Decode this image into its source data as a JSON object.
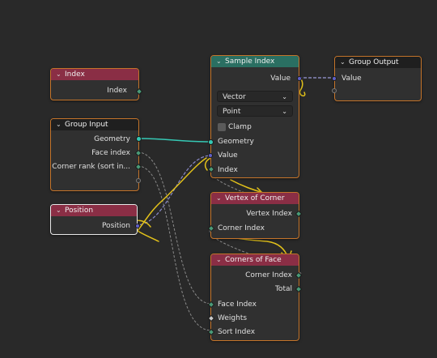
{
  "nodes": {
    "index": {
      "title": "Index",
      "output": "Index"
    },
    "group_input": {
      "title": "Group Input",
      "outputs": [
        "Geometry",
        "Face index",
        "Corner rank (sort in..."
      ]
    },
    "position": {
      "title": "Position",
      "output": "Position"
    },
    "sample_index": {
      "title": "Sample Index",
      "output": "Value",
      "data_type": "Vector",
      "domain": "Point",
      "clamp_label": "Clamp",
      "inputs": [
        "Geometry",
        "Value",
        "Index"
      ]
    },
    "group_output": {
      "title": "Group Output",
      "input": "Value"
    },
    "vertex_of_corner": {
      "title": "Vertex of Corner",
      "output": "Vertex Index",
      "input": "Corner Index"
    },
    "corners_of_face": {
      "title": "Corners of Face",
      "outputs": [
        "Corner Index",
        "Total"
      ],
      "inputs": [
        "Face Index",
        "Weights",
        "Sort Index"
      ]
    }
  },
  "colors": {
    "background": "#292929",
    "node_body": "#303030",
    "node_border_selected": "#c4742a",
    "header_input": "#8a2e45",
    "header_sample": "#2a6f62",
    "header_output": "#1f1f1f",
    "socket_geometry": "#35c8b4",
    "socket_vector": "#6060c8",
    "socket_int": "#4a9a78",
    "annotation_stroke": "#e3c21a"
  },
  "icons": [
    "chevron-down-icon",
    "dropdown-caret-icon",
    "checkbox-icon"
  ]
}
